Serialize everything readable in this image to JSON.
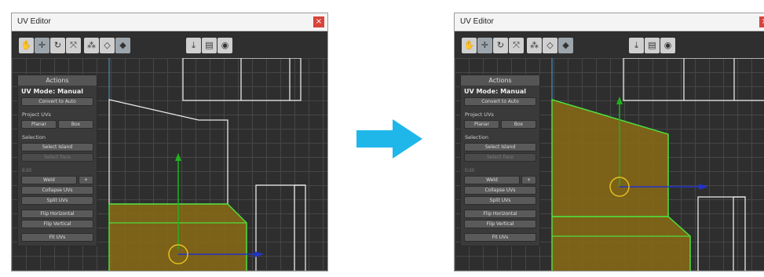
{
  "windows": [
    {
      "id": "before",
      "title": "UV Editor",
      "close_glyph": "×",
      "panel": {
        "header": "Actions",
        "mode": "UV Mode: Manual",
        "convert": "Convert to Auto",
        "project_label": "Project UVs",
        "planar": "Planar",
        "box": "Box",
        "selection_label": "Selection",
        "select_island": "Select Island",
        "select_face": "Select Face",
        "edit_label": "Edit",
        "weld": "Weld",
        "weld_plus": "+",
        "collapse": "Collapse UVs",
        "split": "Split UVs",
        "flip_h": "Flip Horizontal",
        "flip_v": "Flip Vertical",
        "fit": "Fit UVs"
      }
    },
    {
      "id": "after",
      "title": "UV Editor",
      "close_glyph": "×",
      "panel": {
        "header": "Actions",
        "mode": "UV Mode: Manual",
        "convert": "Convert to Auto",
        "project_label": "Project UVs",
        "planar": "Planar",
        "box": "Box",
        "selection_label": "Selection",
        "select_island": "Select Island",
        "select_face": "Select Face",
        "edit_label": "Edit",
        "weld": "Weld",
        "weld_plus": "+",
        "collapse": "Collapse UVs",
        "split": "Split UVs",
        "flip_h": "Flip Horizontal",
        "flip_v": "Flip Vertical",
        "fit": "Fit UVs"
      }
    }
  ],
  "toolbar_icons": [
    "hand-tool-icon",
    "move-tool-icon",
    "rotate-tool-icon",
    "scale-tool-icon",
    "vertex-mode-icon",
    "edge-mode-icon",
    "face-mode-icon",
    "render-uv-icon",
    "save-image-icon",
    "screenshot-icon"
  ],
  "colors": {
    "selection_fill": "#8a6a14",
    "selection_stroke": "#4ee03a",
    "y_axis": "#1db31d",
    "x_axis": "#2233c8",
    "pivot": "#e0c020",
    "transition_arrow": "#1fb7ea",
    "close_button": "#d9443a"
  }
}
